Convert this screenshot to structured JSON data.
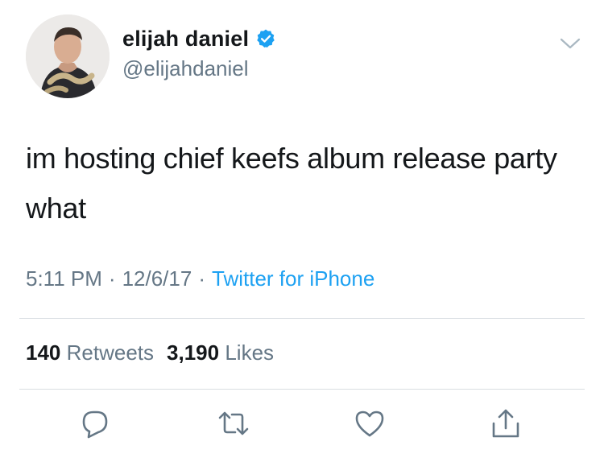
{
  "author": {
    "display_name": "elijah daniel",
    "handle": "@elijahdaniel",
    "verified": true
  },
  "tweet": {
    "text": "im hosting chief keefs album release party what",
    "time": "5:11 PM",
    "date": "12/6/17",
    "separator": "·",
    "source": "Twitter for iPhone"
  },
  "stats": {
    "retweets_count": "140",
    "retweets_label": "Retweets",
    "likes_count": "3,190",
    "likes_label": "Likes"
  },
  "icons": {
    "menu": "chevron-down-icon",
    "reply": "reply-icon",
    "retweet": "retweet-icon",
    "like": "heart-icon",
    "share": "share-icon",
    "verified": "verified-badge-icon"
  },
  "colors": {
    "link": "#1da1f2",
    "secondary_text": "#657786",
    "primary_text": "#14171a",
    "verified": "#1da1f2"
  }
}
